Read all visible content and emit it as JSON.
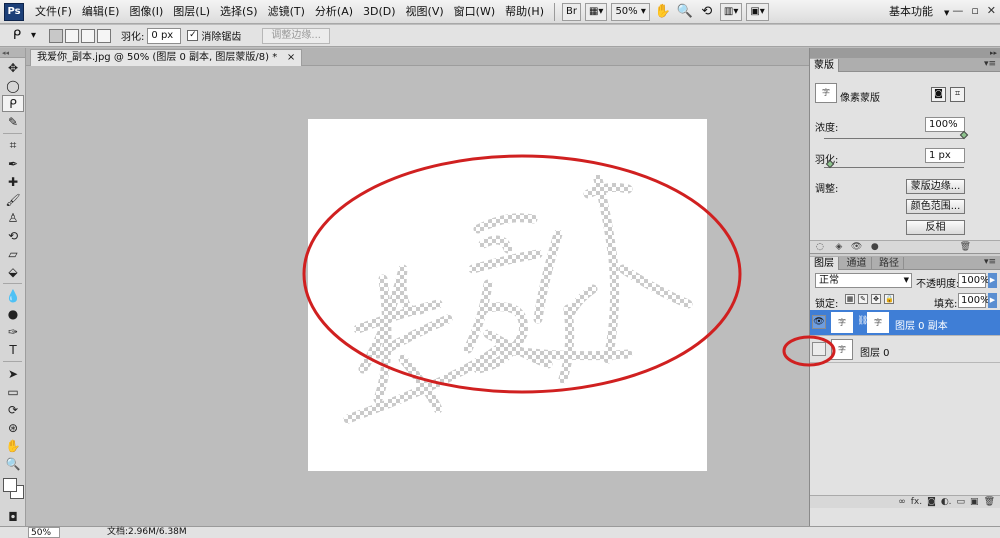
{
  "app": {
    "logo": "Ps",
    "menu": [
      "文件(F)",
      "编辑(E)",
      "图像(I)",
      "图层(L)",
      "选择(S)",
      "滤镜(T)",
      "分析(A)",
      "3D(D)",
      "视图(V)",
      "窗口(W)",
      "帮助(H)"
    ],
    "bridge_btn": "Br",
    "zoom_value": "50%",
    "workspace": "基本功能",
    "win_min": "—",
    "win_restore": "▫",
    "win_close": "✕"
  },
  "options": {
    "feather_label": "羽化:",
    "feather_value": "0 px",
    "antialias_label": "消除锯齿",
    "antialias_checked": "✓",
    "refine_edge": "调整边缘..."
  },
  "document": {
    "tab_title": "我爱你_副本.jpg @ 50% (图层 0 副本, 图层蒙版/8) *",
    "close": "×"
  },
  "toolbox": {
    "tools": [
      {
        "name": "move-tool",
        "glyph": "✥"
      },
      {
        "name": "marquee-tool",
        "glyph": "◯"
      },
      {
        "name": "lasso-tool",
        "glyph": "ᑭ"
      },
      {
        "name": "quick-select-tool",
        "glyph": "✎"
      },
      {
        "name": "crop-tool",
        "glyph": "⌗"
      },
      {
        "name": "eyedropper-tool",
        "glyph": "✒"
      },
      {
        "name": "healing-tool",
        "glyph": "✚"
      },
      {
        "name": "brush-tool",
        "glyph": "🖌"
      },
      {
        "name": "stamp-tool",
        "glyph": "♙"
      },
      {
        "name": "history-brush-tool",
        "glyph": "⟲"
      },
      {
        "name": "eraser-tool",
        "glyph": "▱"
      },
      {
        "name": "paint-bucket-tool",
        "glyph": "⬙"
      },
      {
        "name": "blur-tool",
        "glyph": "💧"
      },
      {
        "name": "dodge-tool",
        "glyph": "●"
      },
      {
        "name": "pen-tool",
        "glyph": "✑"
      },
      {
        "name": "type-tool",
        "glyph": "T"
      },
      {
        "name": "path-select-tool",
        "glyph": "➤"
      },
      {
        "name": "shape-tool",
        "glyph": "▭"
      },
      {
        "name": "3d-rotate-tool",
        "glyph": "⟳"
      },
      {
        "name": "3d-orbit-tool",
        "glyph": "⊛"
      },
      {
        "name": "hand-tool",
        "glyph": "✋"
      },
      {
        "name": "zoom-tool",
        "glyph": "🔍"
      }
    ],
    "quick_mask": "◘"
  },
  "canvas": {
    "artwork_text": "我爱你"
  },
  "status": {
    "zoom": "50%",
    "doc_info": "文档:2.96M/6.38M"
  },
  "masks_panel": {
    "tab": "蒙版",
    "mask_type": "像素蒙版",
    "density_label": "浓度:",
    "density_value": "100%",
    "density_level": 1.0,
    "feather_label": "羽化:",
    "feather_value": "1 px",
    "feather_level": 0.02,
    "adjust_label": "调整:",
    "refine_edge_btn": "蒙版边缘...",
    "color_range_btn": "颜色范围...",
    "invert_btn": "反相"
  },
  "layers_panel": {
    "tabs": [
      "图层",
      "通道",
      "路径"
    ],
    "blend_mode": "正常",
    "opacity_label": "不透明度:",
    "opacity_value": "100%",
    "lock_label": "锁定:",
    "fill_label": "填充:",
    "fill_value": "100%",
    "layers": [
      {
        "name": "图层 0 副本",
        "visible": true,
        "selected": true
      },
      {
        "name": "图层 0",
        "visible": false,
        "selected": false
      }
    ],
    "footer_icons": [
      "∞",
      "fx.",
      "◙",
      "◐.",
      "▭",
      "▣",
      "🗑"
    ]
  },
  "annotation_color": "#d02020"
}
